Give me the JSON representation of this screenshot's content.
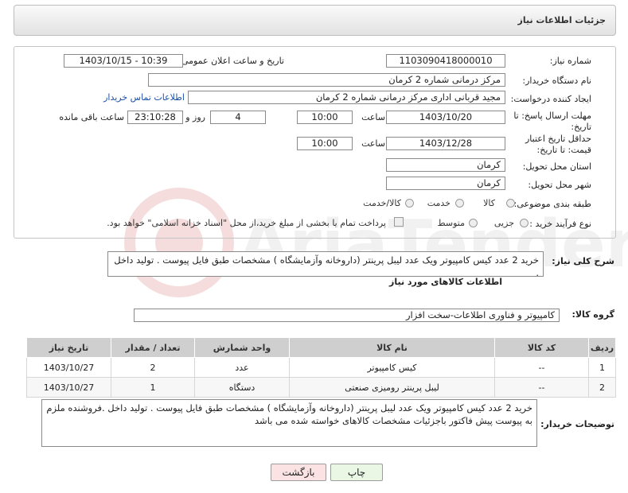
{
  "header": {
    "title": "جزئیات اطلاعات نیاز"
  },
  "form": {
    "need_number": {
      "label": "شماره نیاز:",
      "value": "1103090418000010"
    },
    "announce_datetime": {
      "label": "تاریخ و ساعت اعلان عمومی:",
      "value": "1403/10/15 - 10:39"
    },
    "buyer_org": {
      "label": "نام دستگاه خریدار:",
      "value": "مرکز درمانی شماره 2 کرمان"
    },
    "requester": {
      "label": "ایجاد کننده درخواست:",
      "value": "مجید قربانی اداری  مرکز درمانی شماره 2 کرمان",
      "link": "اطلاعات تماس خریدار"
    },
    "response_deadline": {
      "label": "مهلت ارسال پاسخ: تا تاریخ:",
      "date": "1403/10/20",
      "time_label": "ساعت",
      "time": "10:00",
      "days": "4",
      "days_label": "روز و",
      "remaining": "23:10:28",
      "remaining_label": "ساعت باقی مانده"
    },
    "price_validity": {
      "label": "حداقل تاریخ اعتبار قیمت: تا تاریخ:",
      "date": "1403/12/28",
      "time_label": "ساعت",
      "time": "10:00"
    },
    "delivery_province": {
      "label": "استان محل تحویل:",
      "value": "کرمان"
    },
    "delivery_city": {
      "label": "شهر محل تحویل:",
      "value": "کرمان"
    },
    "category": {
      "label": "طبقه بندی موضوعی:",
      "options": [
        "کالا",
        "خدمت",
        "کالا/خدمت"
      ]
    },
    "purchase_process": {
      "label": "نوع فرآیند خرید :",
      "options": [
        "جزیی",
        "متوسط"
      ],
      "payment_note": "پرداخت تمام یا بخشی از مبلغ خرید،از محل \"اسناد خزانه اسلامی\" خواهد بود."
    }
  },
  "summary": {
    "label": "شرح کلی نیاز:",
    "text": "خرید 2 عدد کیس کامپیوتر ویک عدد لیبل پرینتر (داروخانه وآزمایشگاه ) مشخصات طبق فایل پیوست . تولید داخل ."
  },
  "goods_info": {
    "title": "اطلاعات کالاهای مورد نیاز",
    "group_label": "گروه کالا:",
    "group_value": "کامپیوتر و فناوری اطلاعات-سخت افزار",
    "columns": [
      "ردیف",
      "کد کالا",
      "نام کالا",
      "واحد شمارش",
      "تعداد / مقدار",
      "تاریخ نیاز"
    ],
    "rows": [
      {
        "row": "1",
        "code": "--",
        "name": "کیس کامپیوتر",
        "unit": "عدد",
        "qty": "2",
        "date": "1403/10/27"
      },
      {
        "row": "2",
        "code": "--",
        "name": "لیبل پرینتر رومیزی صنعتی",
        "unit": "دستگاه",
        "qty": "1",
        "date": "1403/10/27"
      }
    ]
  },
  "buyer_notes": {
    "label": "توضیحات خریدار:",
    "text": "خرید 2 عدد کیس کامپیوتر ویک عدد لیبل پرینتر (داروخانه وآزمایشگاه ) مشخصات طبق فایل پیوست . تولید داخل .فروشنده ملزم به پیوست پیش فاکتور باجزئیات مشخصات کالاهای خواسته شده می باشد"
  },
  "buttons": {
    "print": "چاپ",
    "back": "بازگشت"
  },
  "colors": {
    "link": "#1a4fa8",
    "print_bg": "#e9f7e4",
    "back_bg": "#fbe3e3"
  }
}
